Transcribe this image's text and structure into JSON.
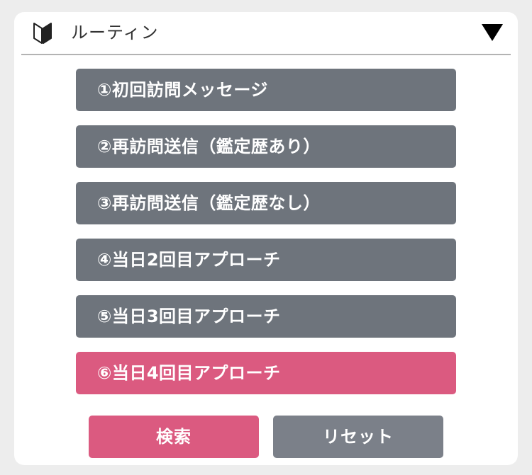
{
  "header": {
    "title": "ルーティン",
    "icon": "beginner-mark-icon",
    "toggle_icon": "triangle-down-icon"
  },
  "routines": [
    {
      "label": "①初回訪問メッセージ",
      "active": false
    },
    {
      "label": "②再訪問送信（鑑定歴あり）",
      "active": false
    },
    {
      "label": "③再訪問送信（鑑定歴なし）",
      "active": false
    },
    {
      "label": "④当日2回目アプローチ",
      "active": false
    },
    {
      "label": "⑤当日3回目アプローチ",
      "active": false
    },
    {
      "label": "⑥当日4回目アプローチ",
      "active": true
    }
  ],
  "actions": {
    "search_label": "検索",
    "reset_label": "リセット"
  },
  "colors": {
    "active": "#db5a80",
    "inactive": "#6e747c",
    "reset": "#7b8089",
    "background": "#ededed"
  }
}
